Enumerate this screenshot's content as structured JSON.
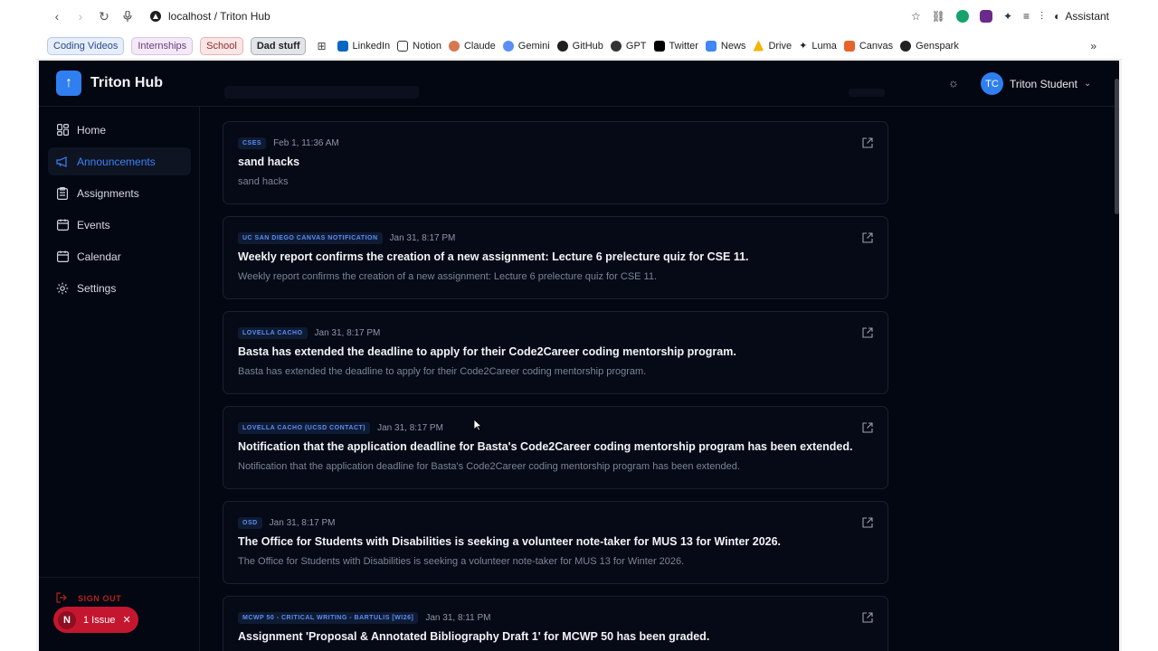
{
  "browser": {
    "url": "localhost / Triton Hub",
    "assistant_label": "Assistant",
    "bookmarks_chips": [
      "Coding Videos",
      "Internships",
      "School",
      "Dad stuff"
    ],
    "bookmarks": [
      "LinkedIn",
      "Notion",
      "Claude",
      "Gemini",
      "GitHub",
      "GPT",
      "Twitter",
      "News",
      "Drive",
      "Luma",
      "Canvas",
      "Genspark"
    ]
  },
  "app": {
    "name": "Triton Hub",
    "user": {
      "initials": "TC",
      "name": "Triton Student"
    },
    "nav": [
      {
        "label": "Home",
        "icon": "grid-icon",
        "active": false
      },
      {
        "label": "Announcements",
        "icon": "megaphone-icon",
        "active": true
      },
      {
        "label": "Assignments",
        "icon": "clipboard-icon",
        "active": false
      },
      {
        "label": "Events",
        "icon": "calendar-icon",
        "active": false
      },
      {
        "label": "Calendar",
        "icon": "calendar-icon",
        "active": false
      },
      {
        "label": "Settings",
        "icon": "gear-icon",
        "active": false
      }
    ],
    "sign_out": "SIGN OUT",
    "issue": {
      "letter": "N",
      "label": "1 Issue"
    }
  },
  "announcements": [
    {
      "source": "CSES",
      "date": "Feb 1, 11:36 AM",
      "title": "sand hacks",
      "desc": "sand hacks"
    },
    {
      "source": "UC SAN DIEGO CANVAS NOTIFICATION",
      "date": "Jan 31, 8:17 PM",
      "title": "Weekly report confirms the creation of a new assignment: Lecture 6 prelecture quiz for CSE 11.",
      "desc": "Weekly report confirms the creation of a new assignment: Lecture 6 prelecture quiz for CSE 11."
    },
    {
      "source": "LOVELLA CACHO",
      "date": "Jan 31, 8:17 PM",
      "title": "Basta has extended the deadline to apply for their Code2Career coding mentorship program.",
      "desc": "Basta has extended the deadline to apply for their Code2Career coding mentorship program."
    },
    {
      "source": "LOVELLA CACHO (UCSD CONTACT)",
      "date": "Jan 31, 8:17 PM",
      "title": "Notification that the application deadline for Basta's Code2Career coding mentorship program has been extended.",
      "desc": "Notification that the application deadline for Basta's Code2Career coding mentorship program has been extended."
    },
    {
      "source": "OSD",
      "date": "Jan 31, 8:17 PM",
      "title": "The Office for Students with Disabilities is seeking a volunteer note-taker for MUS 13 for Winter 2026.",
      "desc": "The Office for Students with Disabilities is seeking a volunteer note-taker for MUS 13 for Winter 2026."
    },
    {
      "source": "MCWP 50 - CRITICAL WRITING - BARTULIS [WI26]",
      "date": "Jan 31, 8:11 PM",
      "title": "Assignment 'Proposal & Annotated Bibliography Draft 1' for MCWP 50 has been graded.",
      "desc": ""
    }
  ],
  "colors": {
    "accent": "#2f7ff0",
    "background": "#030712",
    "tag_text": "#5b8ef5",
    "danger": "#c5162f"
  }
}
